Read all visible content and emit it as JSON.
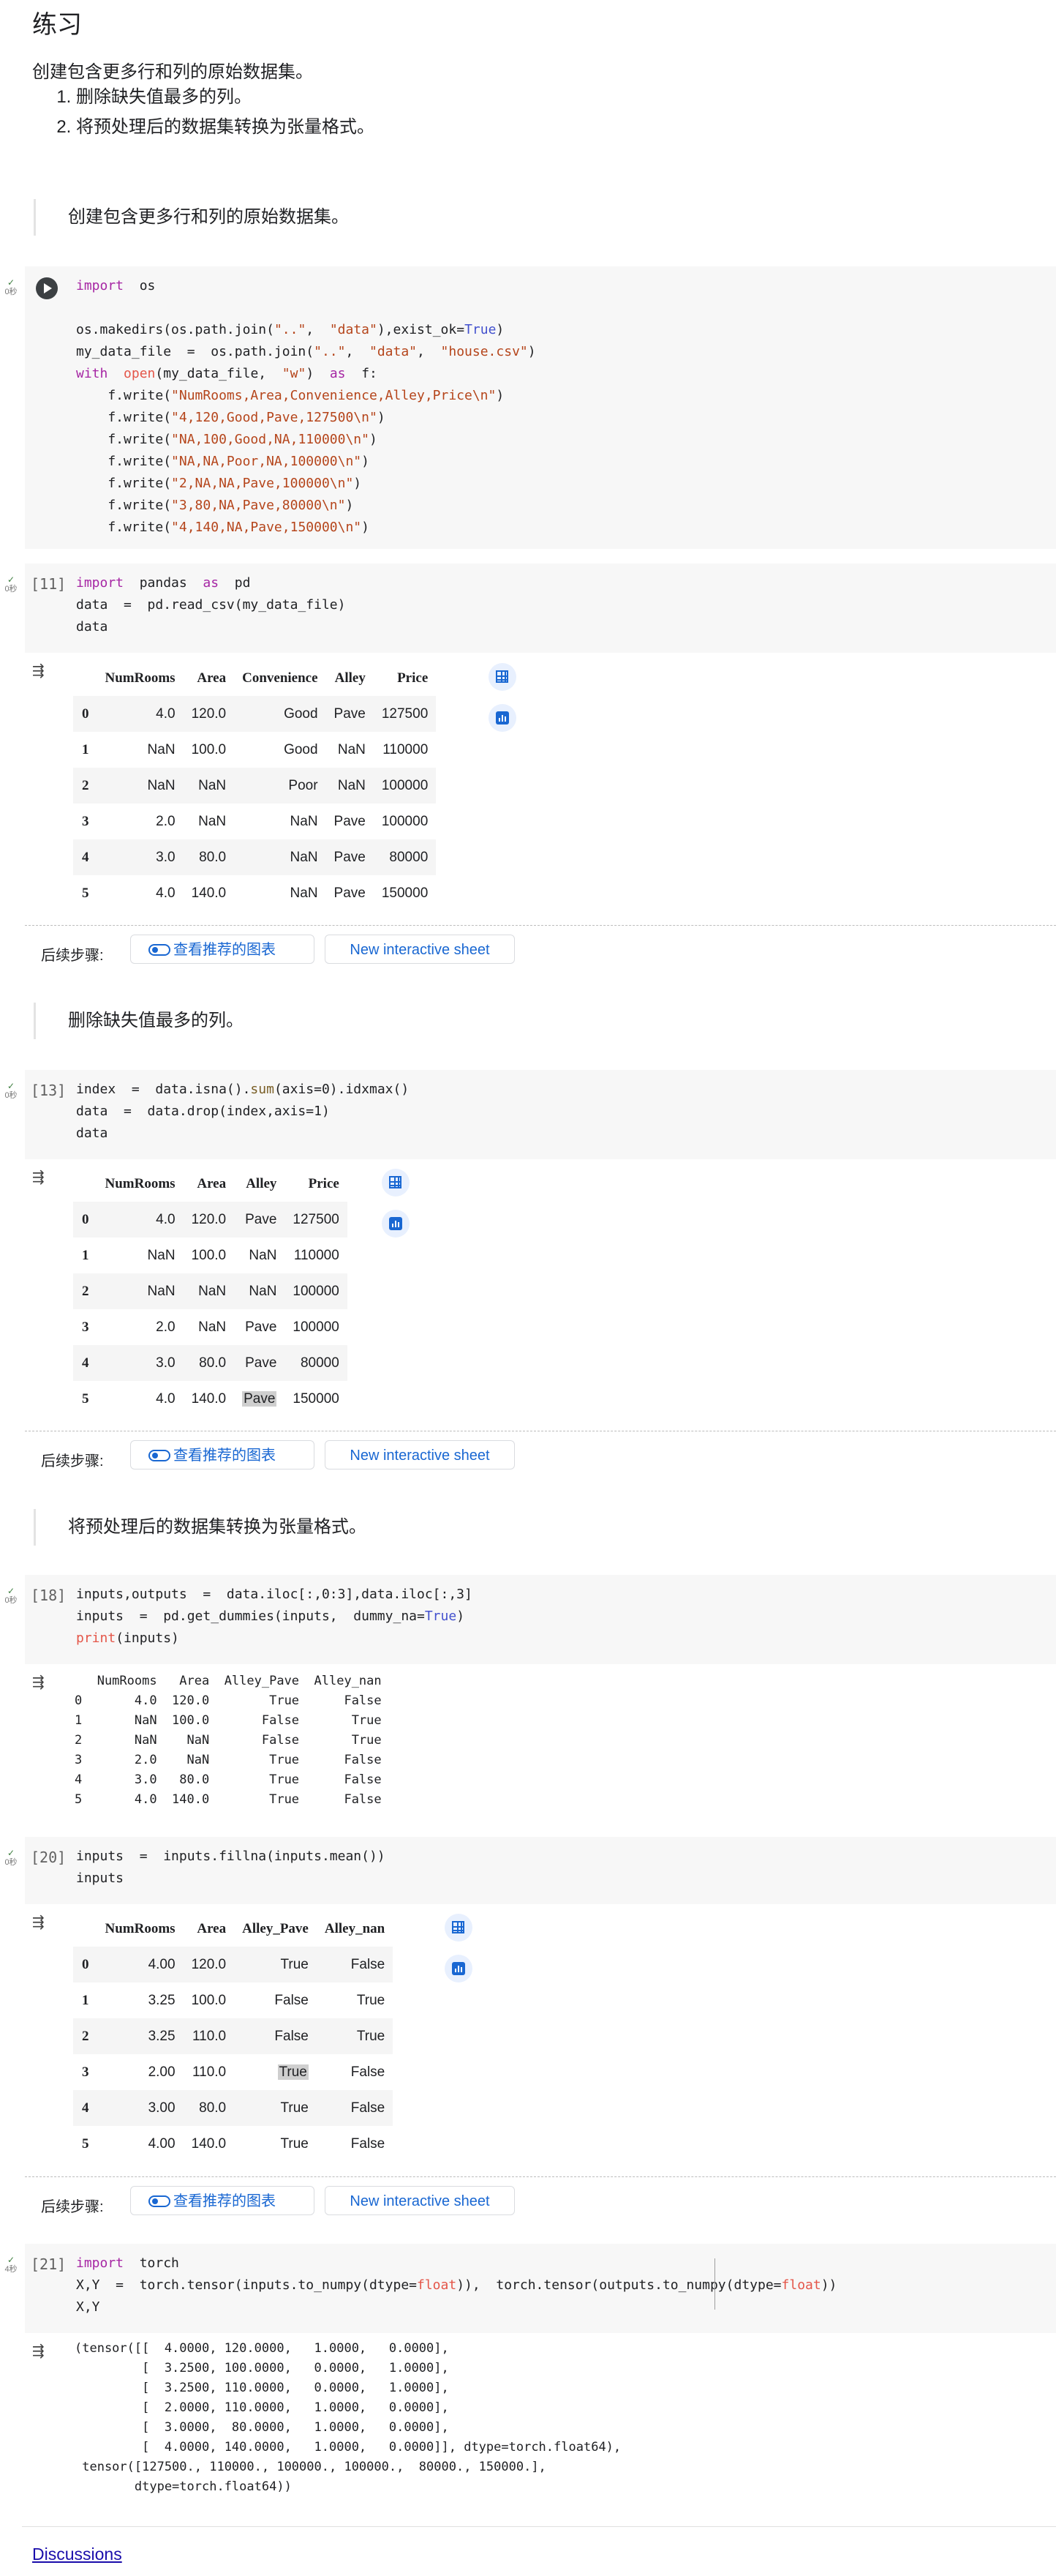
{
  "heading": "练习",
  "intro": "创建包含更多行和列的原始数据集。",
  "tasks": [
    "删除缺失值最多的列。",
    "将预处理后的数据集转换为张量格式。"
  ],
  "quotes": [
    "创建包含更多行和列的原始数据集。",
    "删除缺失值最多的列。",
    "将预处理后的数据集转换为张量格式。"
  ],
  "exec_check": "✓",
  "exec_times": [
    "0秒",
    "0秒",
    "0秒",
    "0秒",
    "0秒",
    "4秒"
  ],
  "prompts": [
    "[11]",
    "[13]",
    "[18]",
    "[20]",
    "[21]"
  ],
  "next_steps": {
    "label": "后续步骤:",
    "charts_label": "查看推荐的图表",
    "sheet_label": "New interactive sheet"
  },
  "table1": {
    "columns": [
      "",
      "NumRooms",
      "Area",
      "Convenience",
      "Alley",
      "Price"
    ],
    "rows": [
      [
        "0",
        "4.0",
        "120.0",
        "Good",
        "Pave",
        "127500"
      ],
      [
        "1",
        "NaN",
        "100.0",
        "Good",
        "NaN",
        "110000"
      ],
      [
        "2",
        "NaN",
        "NaN",
        "Poor",
        "NaN",
        "100000"
      ],
      [
        "3",
        "2.0",
        "NaN",
        "NaN",
        "Pave",
        "100000"
      ],
      [
        "4",
        "3.0",
        "80.0",
        "NaN",
        "Pave",
        "80000"
      ],
      [
        "5",
        "4.0",
        "140.0",
        "NaN",
        "Pave",
        "150000"
      ]
    ]
  },
  "table2": {
    "columns": [
      "",
      "NumRooms",
      "Area",
      "Alley",
      "Price"
    ],
    "rows": [
      [
        "0",
        "4.0",
        "120.0",
        "Pave",
        "127500"
      ],
      [
        "1",
        "NaN",
        "100.0",
        "NaN",
        "110000"
      ],
      [
        "2",
        "NaN",
        "NaN",
        "NaN",
        "100000"
      ],
      [
        "3",
        "2.0",
        "NaN",
        "Pave",
        "100000"
      ],
      [
        "4",
        "3.0",
        "80.0",
        "Pave",
        "80000"
      ],
      [
        "5",
        "4.0",
        "140.0",
        "Pave",
        "150000"
      ]
    ]
  },
  "text_output_1": "   NumRooms   Area  Alley_Pave  Alley_nan\n0       4.0  120.0        True      False\n1       NaN  100.0       False       True\n2       NaN    NaN       False       True\n3       2.0    NaN        True      False\n4       3.0   80.0        True      False\n5       4.0  140.0        True      False",
  "table3": {
    "columns": [
      "",
      "NumRooms",
      "Area",
      "Alley_Pave",
      "Alley_nan"
    ],
    "rows": [
      [
        "0",
        "4.00",
        "120.0",
        "True",
        "False"
      ],
      [
        "1",
        "3.25",
        "100.0",
        "False",
        "True"
      ],
      [
        "2",
        "3.25",
        "110.0",
        "False",
        "True"
      ],
      [
        "3",
        "2.00",
        "110.0",
        "True",
        "False"
      ],
      [
        "4",
        "3.00",
        "80.0",
        "True",
        "False"
      ],
      [
        "5",
        "4.00",
        "140.0",
        "True",
        "False"
      ]
    ]
  },
  "text_output_2": "(tensor([[  4.0000, 120.0000,   1.0000,   0.0000],\n         [  3.2500, 100.0000,   0.0000,   1.0000],\n         [  3.2500, 110.0000,   0.0000,   1.0000],\n         [  2.0000, 110.0000,   1.0000,   0.0000],\n         [  3.0000,  80.0000,   1.0000,   0.0000],\n         [  4.0000, 140.0000,   1.0000,   0.0000]], dtype=torch.float64),\n tensor([127500., 110000., 100000., 100000.,  80000., 150000.],\n        dtype=torch.float64))",
  "code": {
    "c1": [
      [
        [
          "kw",
          "import"
        ],
        [
          "t",
          "  os"
        ]
      ],
      [],
      [
        [
          "t",
          "os.makedirs(os.path.join("
        ],
        [
          "st",
          "\"..\""
        ],
        [
          "t",
          ",  "
        ],
        [
          "st",
          "\"data\""
        ],
        [
          "t",
          "),exist_ok="
        ],
        [
          "cn",
          "True"
        ],
        [
          "t",
          ")"
        ]
      ],
      [
        [
          "t",
          "my_data_file  =  os.path.join("
        ],
        [
          "st",
          "\"..\""
        ],
        [
          "t",
          ",  "
        ],
        [
          "st",
          "\"data\""
        ],
        [
          "t",
          ",  "
        ],
        [
          "st",
          "\"house.csv\""
        ],
        [
          "t",
          ")"
        ]
      ],
      [
        [
          "kw",
          "with"
        ],
        [
          "t",
          "  "
        ],
        [
          "bi",
          "open"
        ],
        [
          "t",
          "(my_data_file,  "
        ],
        [
          "st",
          "\"w\""
        ],
        [
          "t",
          ")  "
        ],
        [
          "kw",
          "as"
        ],
        [
          "t",
          "  f:"
        ]
      ],
      [
        [
          "t",
          "    f.write("
        ],
        [
          "st",
          "\"NumRooms,Area,Convenience,Alley,Price\\n\""
        ],
        [
          "t",
          ")"
        ]
      ],
      [
        [
          "t",
          "    f.write("
        ],
        [
          "st",
          "\"4,120,Good,Pave,127500\\n\""
        ],
        [
          "t",
          ")"
        ]
      ],
      [
        [
          "t",
          "    f.write("
        ],
        [
          "st",
          "\"NA,100,Good,NA,110000\\n\""
        ],
        [
          "t",
          ")"
        ]
      ],
      [
        [
          "t",
          "    f.write("
        ],
        [
          "st",
          "\"NA,NA,Poor,NA,100000\\n\""
        ],
        [
          "t",
          ")"
        ]
      ],
      [
        [
          "t",
          "    f.write("
        ],
        [
          "st",
          "\"2,NA,NA,Pave,100000\\n\""
        ],
        [
          "t",
          ")"
        ]
      ],
      [
        [
          "t",
          "    f.write("
        ],
        [
          "st",
          "\"3,80,NA,Pave,80000\\n\""
        ],
        [
          "t",
          ")"
        ]
      ],
      [
        [
          "t",
          "    f.write("
        ],
        [
          "st",
          "\"4,140,NA,Pave,150000\\n\""
        ],
        [
          "t",
          ")"
        ]
      ]
    ],
    "c2": [
      [
        [
          "kw",
          "import"
        ],
        [
          "t",
          "  pandas  "
        ],
        [
          "kw",
          "as"
        ],
        [
          "t",
          "  pd"
        ]
      ],
      [
        [
          "t",
          "data  =  pd.read_csv(my_data_file)"
        ]
      ],
      [
        [
          "t",
          "data"
        ]
      ]
    ],
    "c3": [
      [
        [
          "t",
          "index  =  data.isna()."
        ],
        [
          "fn",
          "sum"
        ],
        [
          "t",
          "(axis=0).idxmax()"
        ]
      ],
      [
        [
          "t",
          "data  =  data.drop(index,axis=1)"
        ]
      ],
      [
        [
          "t",
          "data"
        ]
      ]
    ],
    "c4": [
      [
        [
          "t",
          "inputs,outputs  =  data.iloc[:,0:3],data.iloc[:,3]"
        ]
      ],
      [
        [
          "t",
          "inputs  =  pd.get_dummies(inputs,  dummy_na="
        ],
        [
          "cn",
          "True"
        ],
        [
          "t",
          ")"
        ]
      ],
      [
        [
          "bi",
          "print"
        ],
        [
          "t",
          "(inputs)"
        ]
      ]
    ],
    "c5": [
      [
        [
          "t",
          "inputs  =  inputs.fillna(inputs.mean())"
        ]
      ],
      [
        [
          "t",
          "inputs"
        ]
      ]
    ],
    "c6": [
      [
        [
          "kw",
          "import"
        ],
        [
          "t",
          "  torch"
        ]
      ],
      [
        [
          "t",
          "X,Y  =  torch.tensor(inputs.to_numpy(dtype="
        ],
        [
          "bi",
          "float"
        ],
        [
          "t",
          ")),  torch.tensor(outputs.to_numpy(dtype="
        ],
        [
          "bi",
          "float"
        ],
        [
          "t",
          "))"
        ]
      ],
      [
        [
          "t",
          "X,Y"
        ]
      ]
    ]
  },
  "footer_link": "Discussions"
}
